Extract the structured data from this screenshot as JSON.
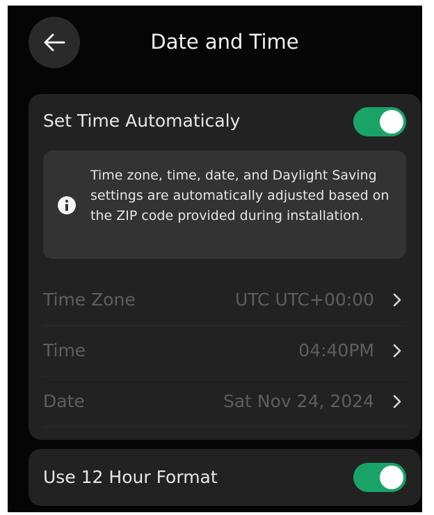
{
  "header": {
    "title": "Date and Time",
    "back_icon": "arrow-left-icon"
  },
  "auto_time": {
    "label": "Set Time Automaticaly",
    "toggle_on": true,
    "info_icon": "info-icon",
    "info_text": "Time zone, time, date, and Daylight Saving settings are automatically adjusted based on the ZIP code provided during installation."
  },
  "settings": [
    {
      "label": "Time Zone",
      "value": "UTC UTC+00:00"
    },
    {
      "label": "Time",
      "value": "04:40PM"
    },
    {
      "label": "Date",
      "value": "Sat Nov 24, 2024"
    }
  ],
  "hour_format": {
    "label": "Use 12 Hour Format",
    "toggle_on": true
  },
  "colors": {
    "background": "#050505",
    "card": "#222222",
    "info_box": "#333333",
    "accent": "#1aa367",
    "disabled_text": "#5e5e5e"
  }
}
